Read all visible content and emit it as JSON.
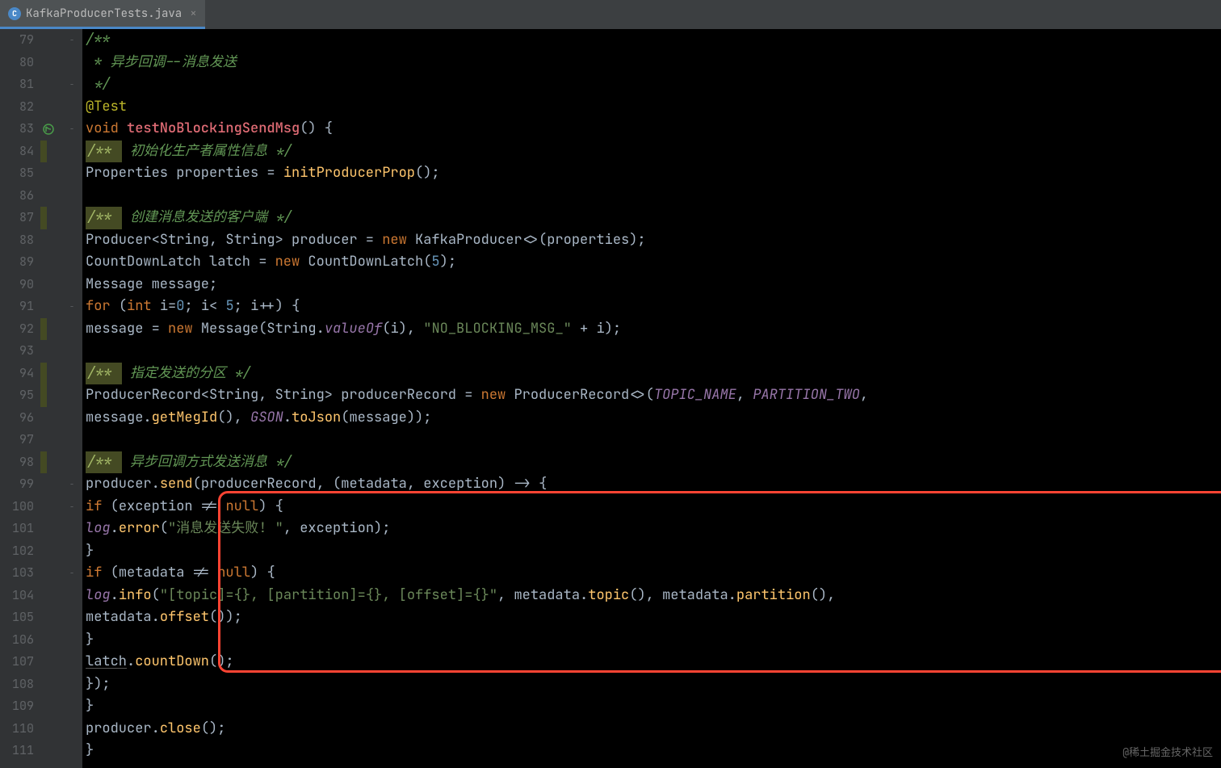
{
  "tab": {
    "filename": "KafkaProducerTests.java",
    "icon_letter": "C"
  },
  "line_numbers": [
    "79",
    "80",
    "81",
    "82",
    "83",
    "84",
    "85",
    "86",
    "87",
    "88",
    "89",
    "90",
    "91",
    "92",
    "93",
    "94",
    "95",
    "96",
    "97",
    "98",
    "99",
    "100",
    "101",
    "102",
    "103",
    "104",
    "105",
    "106",
    "107",
    "108",
    "109",
    "110",
    "111"
  ],
  "code": {
    "l79": "/**",
    "l80_prefix": " * ",
    "l80_text": "异步回调--消息发送",
    "l81": " */",
    "l82": "@Test",
    "l83_kw": "void ",
    "l83_method": "testNoBlockingSendMsg",
    "l83_rest": "() {",
    "l84_doc": "/** ",
    "l84_text": " 初始化生产者属性信息 */",
    "l85_a": "Properties ",
    "l85_b": "properties",
    "l85_c": " = ",
    "l85_d": "initProducerProp",
    "l85_e": "();",
    "l87_doc": "/** ",
    "l87_text": " 创建消息发送的客户端 */",
    "l88_a": "Producer<String, String> ",
    "l88_b": "producer",
    "l88_c": " = ",
    "l88_d": "new ",
    "l88_e": "KafkaProducer<>(",
    "l88_f": "properties",
    "l88_g": ");",
    "l89_a": "CountDownLatch ",
    "l89_b": "latch",
    "l89_c": " = ",
    "l89_d": "new ",
    "l89_e": "CountDownLatch(",
    "l89_f": "5",
    "l89_g": ");",
    "l90_a": "Message ",
    "l90_b": "message",
    "l90_c": ";",
    "l91_a": "for ",
    "l91_b": "(",
    "l91_c": "int ",
    "l91_d": "i",
    "l91_e": "=",
    "l91_f": "0",
    "l91_g": "; ",
    "l91_h": "i",
    "l91_i": "< ",
    "l91_j": "5",
    "l91_k": "; ",
    "l91_l": "i",
    "l91_m": "++) {",
    "l92_a": "message",
    "l92_b": " = ",
    "l92_c": "new ",
    "l92_d": "Message(String.",
    "l92_e": "valueOf",
    "l92_f": "(",
    "l92_g": "i",
    "l92_h": "), ",
    "l92_i": "\"NO_BLOCKING_MSG_\"",
    "l92_j": " + ",
    "l92_k": "i",
    "l92_l": ");",
    "l94_doc": "/** ",
    "l94_text": " 指定发送的分区 */",
    "l95_a": "ProducerRecord<String, String> ",
    "l95_b": "producerRecord",
    "l95_c": " = ",
    "l95_d": "new ",
    "l95_e": "ProducerRecord<>(",
    "l95_f": "TOPIC_NAME",
    "l95_g": ", ",
    "l95_h": "PARTITION_TWO",
    "l95_i": ",",
    "l96_a": "message",
    "l96_b": ".",
    "l96_c": "getMegId",
    "l96_d": "(), ",
    "l96_e": "GSON",
    "l96_f": ".",
    "l96_g": "toJson",
    "l96_h": "(",
    "l96_i": "message",
    "l96_j": "));",
    "l98_doc": "/** ",
    "l98_text": " 异步回调方式发送消息 */",
    "l99_a": "producer",
    "l99_b": ".",
    "l99_c": "send",
    "l99_d": "(",
    "l99_e": "producerRecord",
    "l99_f": ", (",
    "l99_g": "metadata",
    "l99_h": ", ",
    "l99_i": "exception",
    "l99_j": ") -> {",
    "l100_a": "if ",
    "l100_b": "(",
    "l100_c": "exception",
    "l100_d": " != ",
    "l100_e": "null",
    "l100_f": ") {",
    "l101_a": "log",
    "l101_b": ".",
    "l101_c": "error",
    "l101_d": "(",
    "l101_e": "\"消息发送失败! \"",
    "l101_f": ", ",
    "l101_g": "exception",
    "l101_h": ");",
    "l102": "}",
    "l103_a": "if ",
    "l103_b": "(",
    "l103_c": "metadata",
    "l103_d": " != ",
    "l103_e": "null",
    "l103_f": ") {",
    "l104_a": "log",
    "l104_b": ".",
    "l104_c": "info",
    "l104_d": "(",
    "l104_e": "\"[topic]={}, [partition]={}, [offset]={}\"",
    "l104_f": ", ",
    "l104_g": "metadata",
    "l104_h": ".",
    "l104_i": "topic",
    "l104_j": "(), ",
    "l104_k": "metadata",
    "l104_l": ".",
    "l104_m": "partition",
    "l104_n": "(),",
    "l105_a": "metadata",
    "l105_b": ".",
    "l105_c": "offset",
    "l105_d": "());",
    "l106": "}",
    "l107_a": "latch",
    "l107_b": ".",
    "l107_c": "countDown",
    "l107_d": "();",
    "l108": "});",
    "l109": "}",
    "l110_a": "producer",
    "l110_b": ".",
    "l110_c": "close",
    "l110_d": "();",
    "l111": "}"
  },
  "watermark": "@稀土掘金技术社区"
}
